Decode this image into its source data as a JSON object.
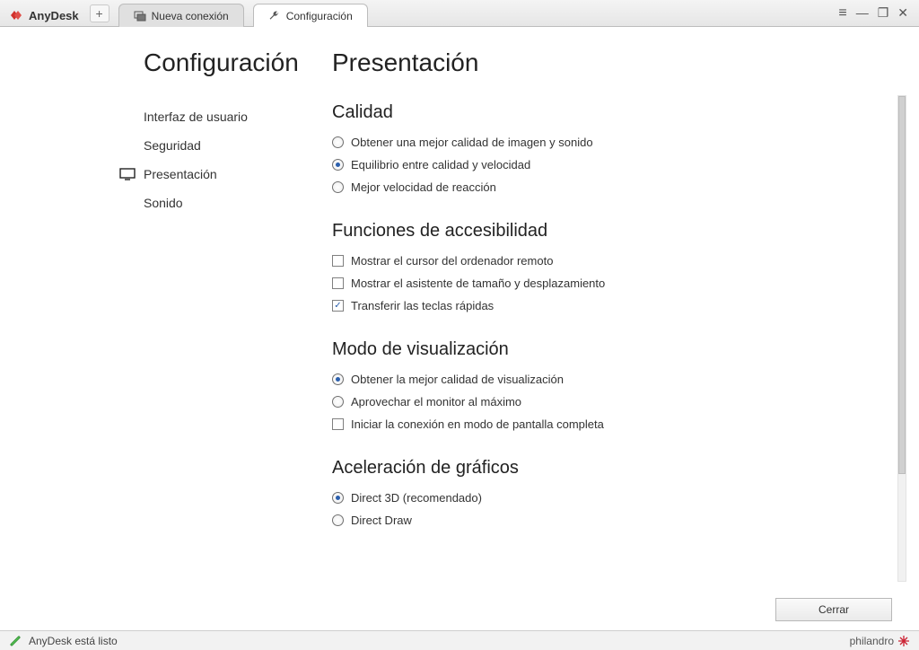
{
  "app": {
    "name": "AnyDesk"
  },
  "tabs": [
    {
      "label": "Nueva conexión",
      "active": false
    },
    {
      "label": "Configuración",
      "active": true
    }
  ],
  "leftcol": {
    "title": "Configuración",
    "items": [
      {
        "label": "Interfaz de usuario"
      },
      {
        "label": "Seguridad"
      },
      {
        "label": "Presentación"
      },
      {
        "label": "Sonido"
      }
    ]
  },
  "rightcol": {
    "title": "Presentación",
    "sections": {
      "quality": {
        "heading": "Calidad",
        "opts": [
          "Obtener una mejor calidad de imagen y sonido",
          "Equilibrio entre calidad y velocidad",
          "Mejor velocidad de reacción"
        ]
      },
      "access": {
        "heading": "Funciones de accesibilidad",
        "opts": [
          "Mostrar el cursor del ordenador remoto",
          "Mostrar el asistente de tamaño y desplazamiento",
          "Transferir las teclas rápidas"
        ]
      },
      "view": {
        "heading": "Modo de visualización",
        "radios": [
          "Obtener la mejor calidad de visualización",
          "Aprovechar el monitor al máximo"
        ],
        "check": "Iniciar la conexión en modo de pantalla completa"
      },
      "gfx": {
        "heading": "Aceleración de gráficos",
        "opts": [
          "Direct 3D (recomendado)",
          "Direct Draw"
        ]
      }
    }
  },
  "footer": {
    "close": "Cerrar"
  },
  "status": {
    "text": "AnyDesk está listo",
    "brand": "philandro"
  }
}
